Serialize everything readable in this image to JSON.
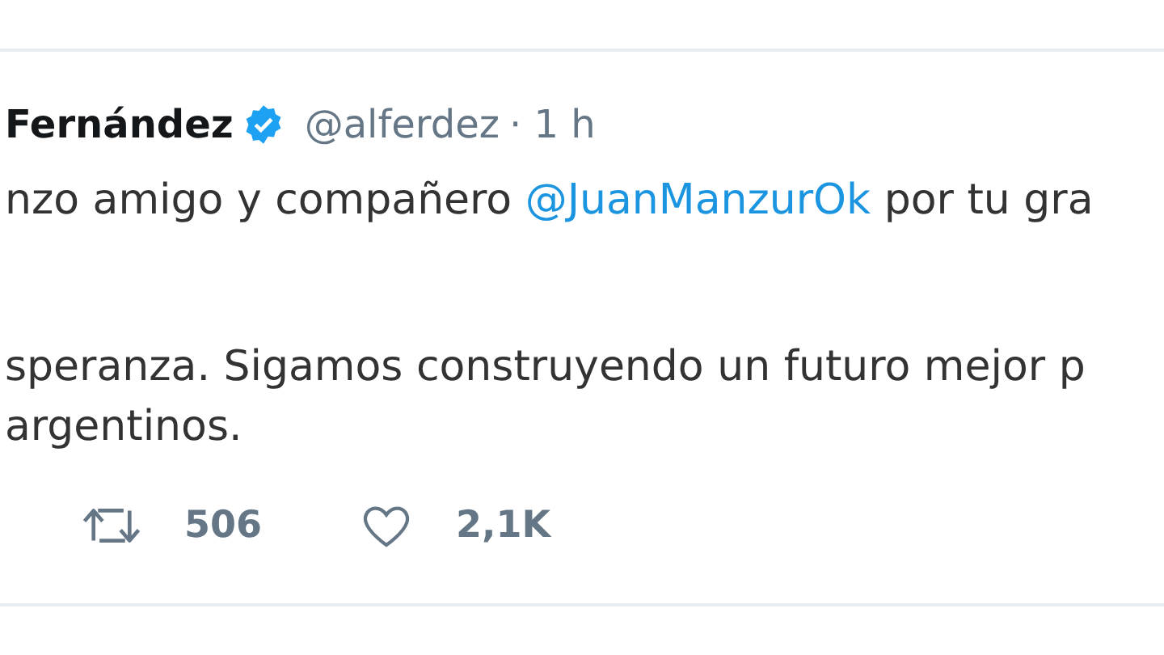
{
  "tweet": {
    "name": "Fernández",
    "verified": true,
    "handle": "@alferdez",
    "time": "· 1 h",
    "lines": [
      [
        {
          "text": "nzo amigo y compañero ",
          "kind": "plain"
        },
        {
          "text": "@JuanManzurOk",
          "kind": "mention"
        },
        {
          "text": " por tu gra",
          "kind": "plain"
        }
      ],
      [
        {
          "text": "speranza. Sigamos construyendo un futuro mejor p",
          "kind": "plain"
        }
      ],
      [
        {
          "text": "argentinos.",
          "kind": "plain"
        }
      ]
    ],
    "retweets": "506",
    "likes": "2,1K"
  }
}
